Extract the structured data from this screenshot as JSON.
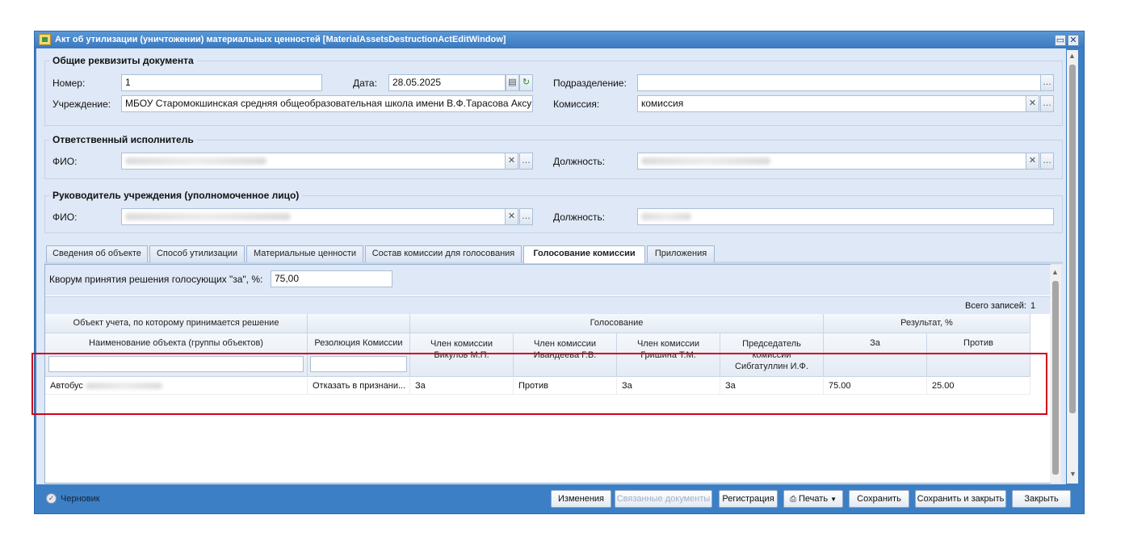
{
  "window": {
    "title": "Акт об утилизации (уничтожении) материальных ценностей [MaterialAssetsDestructionActEditWindow]",
    "restore_icon": "▭",
    "close_icon": "✕"
  },
  "general": {
    "legend": "Общие реквизиты документа",
    "number_label": "Номер:",
    "number_value": "1",
    "date_label": "Дата:",
    "date_value": "28.05.2025",
    "division_label": "Подразделение:",
    "division_value": "",
    "institution_label": "Учреждение:",
    "institution_value": "МБОУ Старомокшинская средняя общеобразовательная школа имени В.Ф.Тарасова Аксубаевского",
    "commission_label": "Комиссия:",
    "commission_value": "комиссия"
  },
  "executor": {
    "legend": "Ответственный исполнитель",
    "fio_label": "ФИО:",
    "position_label": "Должность:"
  },
  "head": {
    "legend": "Руководитель учреждения (уполномоченное лицо)",
    "fio_label": "ФИО:",
    "position_label": "Должность:"
  },
  "tabs": [
    {
      "label": "Сведения об объекте"
    },
    {
      "label": "Способ утилизации"
    },
    {
      "label": "Материальные ценности"
    },
    {
      "label": "Состав комиссии для голосования"
    },
    {
      "label": "Голосование комиссии"
    },
    {
      "label": "Приложения"
    }
  ],
  "active_tab": "Голосование комиссии",
  "quorum": {
    "label": "Кворум принятия решения голосующих \"за\", %:",
    "value": "75,00"
  },
  "grid": {
    "total_label": "Всего записей:",
    "total_value": "1",
    "group_headers": {
      "object": "Объект учета, по которому принимается решение",
      "voting": "Голосование",
      "result": "Результат, %"
    },
    "columns": [
      "Наименование объекта (группы объектов)",
      "Резолюция Комиссии",
      "Член комиссии Бикулов М.П.",
      "Член комиссии Ивандеева Г.В.",
      "Член комиссии Гришина Т.М.",
      "Председатель комиссии Сибгатуллин И.Ф.",
      "За",
      "Против"
    ],
    "rows": [
      {
        "name": "Автобус",
        "resolution": "Отказать в признани...",
        "m1": "За",
        "m2": "Против",
        "m3": "За",
        "chair": "За",
        "for": "75.00",
        "against": "25.00"
      }
    ]
  },
  "status": {
    "label": "Черновик"
  },
  "buttons": {
    "changes": "Изменения",
    "linked_docs": "Связанные документы",
    "registration": "Регистрация",
    "print": "Печать",
    "save": "Сохранить",
    "save_close": "Сохранить и закрыть",
    "close": "Закрыть"
  },
  "colors": {
    "window_blue": "#3d7fc4",
    "panel_bg": "#dfe8f6",
    "highlight": "#d0021b"
  }
}
